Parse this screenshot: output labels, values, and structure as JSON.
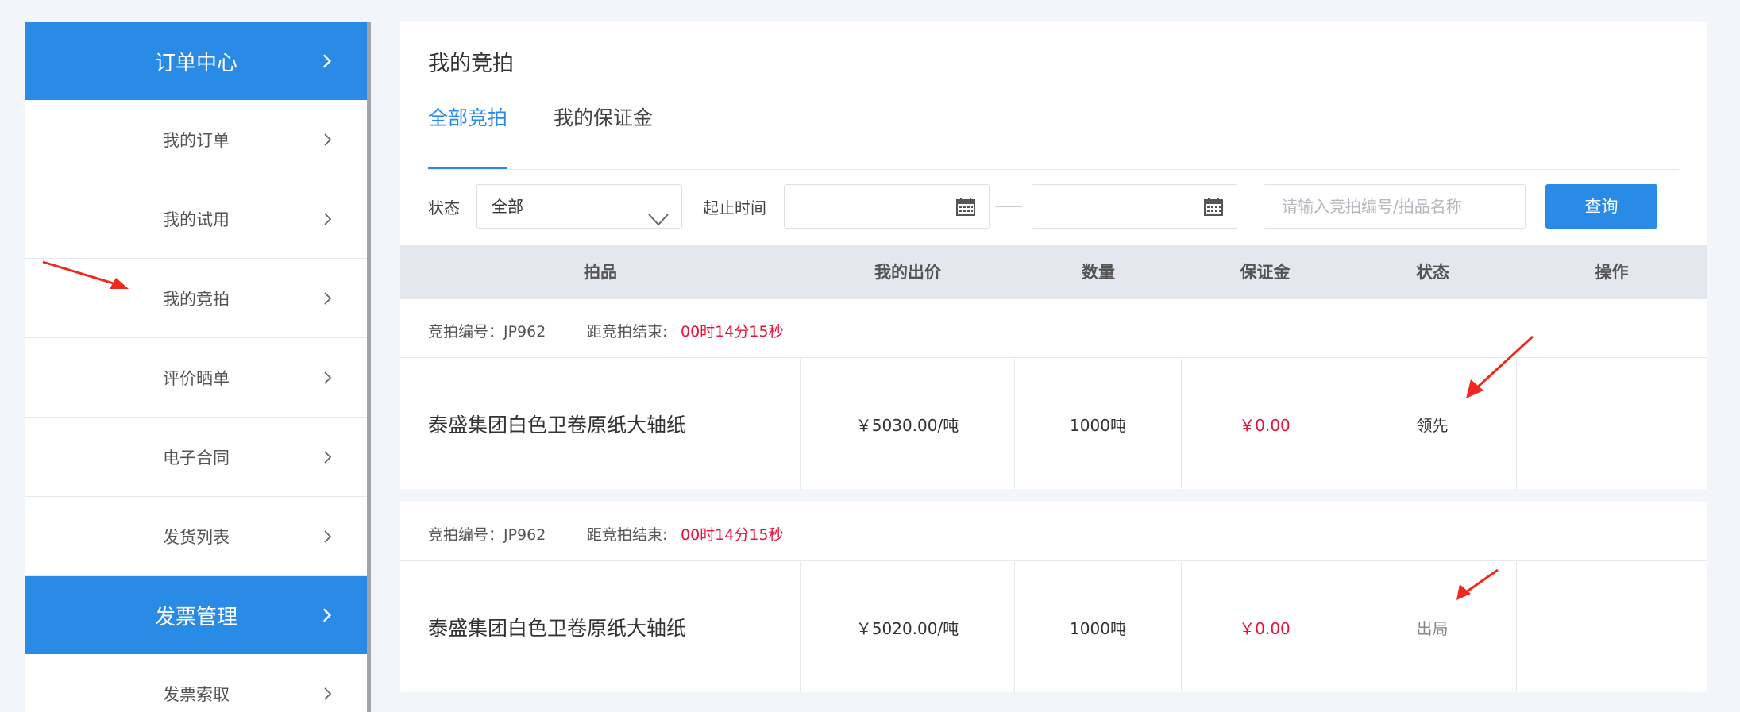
{
  "sidebar": {
    "sections": [
      {
        "title": "订单中心",
        "items": [
          "我的订单",
          "我的试用",
          "我的竞拍",
          "评价晒单",
          "电子合同",
          "发货列表"
        ]
      },
      {
        "title": "发票管理",
        "items": [
          "发票索取"
        ]
      }
    ]
  },
  "page": {
    "title": "我的竞拍",
    "tabs": [
      {
        "label": "全部竞拍",
        "active": true
      },
      {
        "label": "我的保证金",
        "active": false
      }
    ]
  },
  "filters": {
    "status_label": "状态",
    "status_value": "全部",
    "time_label": "起止时间",
    "start_date": "",
    "end_date": "",
    "search_placeholder": "请输入竞拍编号/拍品名称",
    "query_label": "查询"
  },
  "table": {
    "columns": [
      "拍品",
      "我的出价",
      "数量",
      "保证金",
      "状态",
      "操作"
    ],
    "rows": [
      {
        "auction_no_label": "竞拍编号：JP962",
        "end_label": "距竞拍结束:",
        "end_value": "00时14分15秒",
        "item": "泰盛集团白色卫卷原纸大轴纸",
        "bid": "￥5030.00/吨",
        "quantity": "1000吨",
        "deposit": "￥0.00",
        "status": "领先",
        "action": ""
      },
      {
        "auction_no_label": "竞拍编号：JP962",
        "end_label": "距竞拍结束:",
        "end_value": "00时14分15秒",
        "item": "泰盛集团白色卫卷原纸大轴纸",
        "bid": "￥5020.00/吨",
        "quantity": "1000吨",
        "deposit": "￥0.00",
        "status": "出局",
        "action": ""
      }
    ]
  },
  "colors": {
    "primary": "#2a8be6",
    "alert": "#e4143c",
    "annotation": "#f0281e"
  }
}
